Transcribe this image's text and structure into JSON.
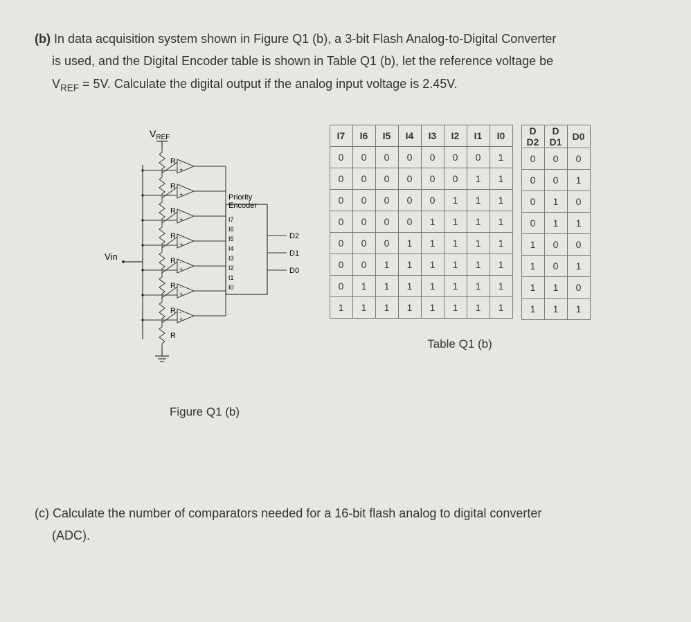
{
  "partB": {
    "label": "(b)",
    "line1_a": "In data acquisition system shown in Figure Q1 (b), a 3-bit Flash Analog-to-Digital Converter",
    "line2": "is used, and the Digital Encoder table is shown in Table Q1 (b), let the reference voltage be",
    "line3_prefix": "V",
    "line3_sub": "REF",
    "line3_rest": " = 5V. Calculate the digital output if the analog input voltage is 2.45V."
  },
  "figure": {
    "vref_v": "V",
    "vref_sub": "REF",
    "vin": "Vin",
    "R": "R",
    "encoder_l1": "Priority",
    "encoder_l2": "Encoder",
    "pins": [
      "I7",
      "I6",
      "I5",
      "I4",
      "I3",
      "I2",
      "I1",
      "I0"
    ],
    "outs": [
      "D2",
      "D1",
      "D0"
    ],
    "caption": "Figure Q1 (b)"
  },
  "table": {
    "headers_left": [
      "I7",
      "I6",
      "I5",
      "I4",
      "I3",
      "I2",
      "I1",
      "I0"
    ],
    "headers_right": [
      "D2",
      "D1",
      "D0"
    ],
    "header_right_top": [
      "D",
      "D",
      ""
    ],
    "rows_left": [
      [
        "0",
        "0",
        "0",
        "0",
        "0",
        "0",
        "0",
        "1"
      ],
      [
        "0",
        "0",
        "0",
        "0",
        "0",
        "0",
        "1",
        "1"
      ],
      [
        "0",
        "0",
        "0",
        "0",
        "0",
        "1",
        "1",
        "1"
      ],
      [
        "0",
        "0",
        "0",
        "0",
        "1",
        "1",
        "1",
        "1"
      ],
      [
        "0",
        "0",
        "0",
        "1",
        "1",
        "1",
        "1",
        "1"
      ],
      [
        "0",
        "0",
        "1",
        "1",
        "1",
        "1",
        "1",
        "1"
      ],
      [
        "0",
        "1",
        "1",
        "1",
        "1",
        "1",
        "1",
        "1"
      ],
      [
        "1",
        "1",
        "1",
        "1",
        "1",
        "1",
        "1",
        "1"
      ]
    ],
    "rows_right": [
      [
        "0",
        "0",
        "0"
      ],
      [
        "0",
        "0",
        "1"
      ],
      [
        "0",
        "1",
        "0"
      ],
      [
        "0",
        "1",
        "1"
      ],
      [
        "1",
        "0",
        "0"
      ],
      [
        "1",
        "0",
        "1"
      ],
      [
        "1",
        "1",
        "0"
      ],
      [
        "1",
        "1",
        "1"
      ]
    ],
    "caption": "Table Q1 (b)"
  },
  "partC": {
    "label": "(c)",
    "text": "Calculate the number of comparators needed for a 16-bit flash analog to digital converter",
    "line2": "(ADC)."
  },
  "chart_data": {
    "type": "table",
    "title": "3-bit Flash ADC Priority Encoder truth table",
    "inputs": [
      "I7",
      "I6",
      "I5",
      "I4",
      "I3",
      "I2",
      "I1",
      "I0"
    ],
    "outputs": [
      "D2",
      "D1",
      "D0"
    ],
    "rows": [
      {
        "I": [
          0,
          0,
          0,
          0,
          0,
          0,
          0,
          1
        ],
        "D": [
          0,
          0,
          0
        ]
      },
      {
        "I": [
          0,
          0,
          0,
          0,
          0,
          0,
          1,
          1
        ],
        "D": [
          0,
          0,
          1
        ]
      },
      {
        "I": [
          0,
          0,
          0,
          0,
          0,
          1,
          1,
          1
        ],
        "D": [
          0,
          1,
          0
        ]
      },
      {
        "I": [
          0,
          0,
          0,
          0,
          1,
          1,
          1,
          1
        ],
        "D": [
          0,
          1,
          1
        ]
      },
      {
        "I": [
          0,
          0,
          0,
          1,
          1,
          1,
          1,
          1
        ],
        "D": [
          1,
          0,
          0
        ]
      },
      {
        "I": [
          0,
          0,
          1,
          1,
          1,
          1,
          1,
          1
        ],
        "D": [
          1,
          0,
          1
        ]
      },
      {
        "I": [
          0,
          1,
          1,
          1,
          1,
          1,
          1,
          1
        ],
        "D": [
          1,
          1,
          0
        ]
      },
      {
        "I": [
          1,
          1,
          1,
          1,
          1,
          1,
          1,
          1
        ],
        "D": [
          1,
          1,
          1
        ]
      }
    ]
  }
}
